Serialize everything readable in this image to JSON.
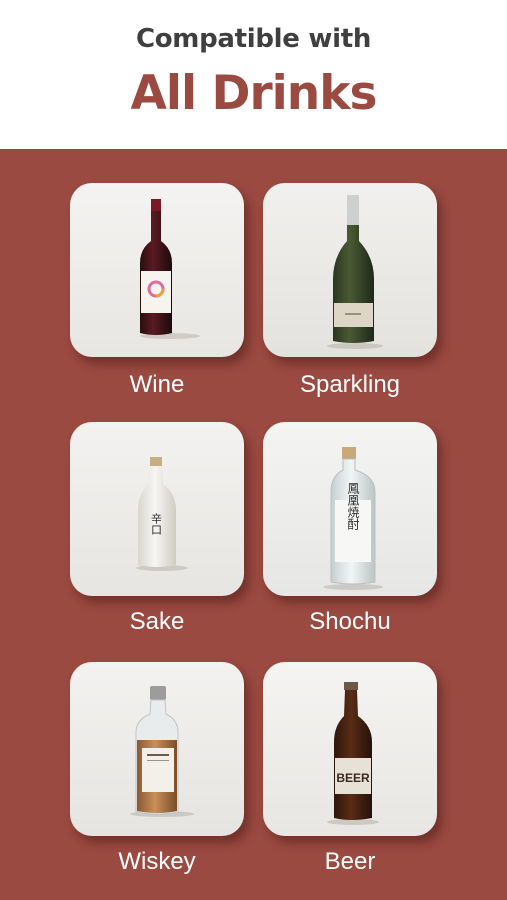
{
  "header": {
    "subtitle": "Compatible with",
    "title": "All Drinks"
  },
  "drinks": [
    {
      "label": "Wine",
      "icon": "wine-bottle-icon"
    },
    {
      "label": "Sparkling",
      "icon": "champagne-bottle-icon"
    },
    {
      "label": "Sake",
      "icon": "sake-bottle-icon"
    },
    {
      "label": "Shochu",
      "icon": "shochu-bottle-icon"
    },
    {
      "label": "Wiskey",
      "icon": "whiskey-bottle-icon"
    },
    {
      "label": "Beer",
      "icon": "beer-bottle-icon"
    }
  ],
  "bottle_text": {
    "sake": "辛口",
    "shochu": "鳳凰焼酎",
    "beer": "BEER"
  },
  "colors": {
    "accent": "#9b4a41",
    "title": "#9a4a41",
    "subtitle": "#3f3f3f"
  }
}
